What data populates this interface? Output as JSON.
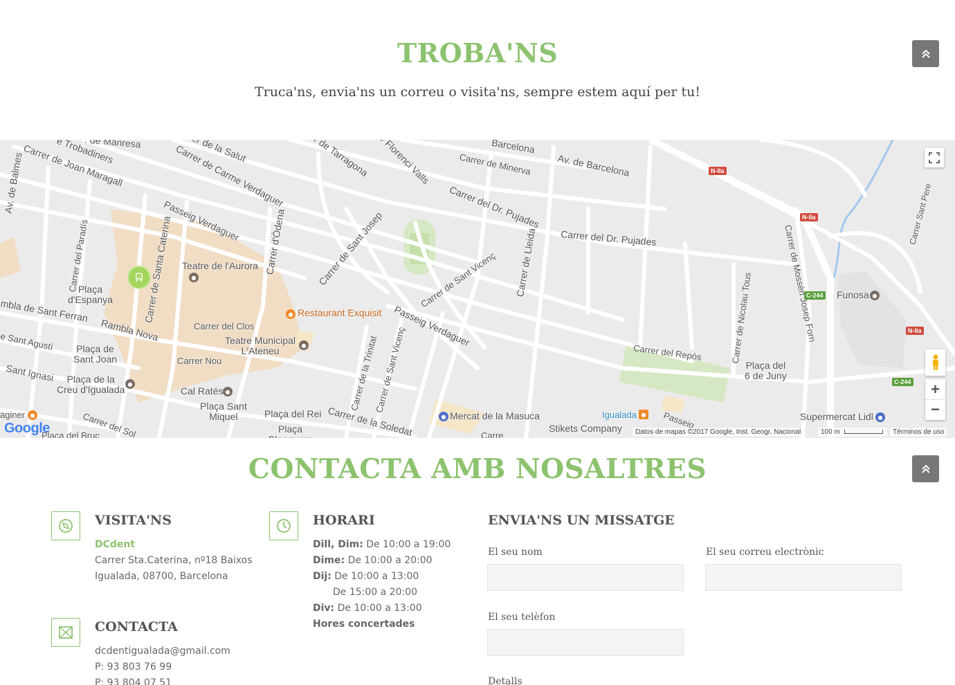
{
  "find": {
    "title": "TROBA'NS",
    "subtitle": "Truca'ns, envia'ns un correu o visita'ns, sempre estem aquí per tu!"
  },
  "map": {
    "streets": [
      "Carrer de Joan Maragall",
      "e Trobadiners",
      ". de Manresa",
      "Carrer de Carme Verdaguer",
      "er de la Salut",
      "er de Tarragona",
      "de Florenci Valls",
      "Barcelona",
      "Carrer de Minerva",
      "Av. de Barcelona",
      "Carrer del Dr. Pujades",
      "Carrer del Dr. Pujades",
      "Passeig Verdaguer",
      "Carrer d'Òdena",
      "Carrer de Sant Josep",
      "Carrer de Sant Vicenç",
      "Carrer de Lleida",
      "Carrer del Paradís",
      "Av. de Balmes",
      "Carrer de Santa Caterina",
      "mbla de Sant Ferran",
      "Rambla Nova",
      "e Sant Agustí",
      "Sant Ignasi",
      "Carrer del Clos",
      "Carrer Nou",
      "Passeig Verdaguer",
      "Carrer de la Trinitat",
      "Carrer de Sant Vicenç",
      "Carrer de la Soledat",
      "Carrer del Sol",
      "Carrer del Repòs",
      "Carrer de Nicolau Tous",
      "Carrer de Mossèn Josep Forn",
      "Carrer Sant Pere",
      "Passeig"
    ],
    "places": {
      "teatre_aurora": "Teatre de l'Aurora",
      "placa_espanya": "Plaça\nd'Espanya",
      "restaurant": "Restaurant Exquisit",
      "teatre_municipal": "Teatre Municipal\nL'Ateneu",
      "placa_sant_joan": "Plaça de\nSant Joan",
      "placa_creu": "Plaça de la\nCreu d'Igualada",
      "cal_rates": "Cal Ratés",
      "placa_sant_miquel": "Plaça Sant\nMiquel",
      "placa_rei": "Plaça del Rei",
      "placa_blanquers": "Plaça\nBlanquers",
      "placa_bruc": "Plaça del Bruc",
      "mercat": "Mercat de la Masuca",
      "igualada": "Igualada",
      "stikets": "Stikets Company",
      "placa_6_juny": "Plaça del\n6 de Juny",
      "funosa": "Funosa",
      "lidl": "Supermercat Lidl",
      "aginer": "aginer",
      "carre": "Carre"
    },
    "shields": [
      "N-IIa",
      "N-IIa",
      "N-IIa",
      "C-244",
      "C-244"
    ],
    "attribution": "Datos de mapas ©2017 Google, Inst. Geogr. Nacional",
    "scale": "100 m",
    "terms": "Términos de uso",
    "logo": "Google"
  },
  "contact": {
    "title": "CONTACTA AMB NOSALTRES",
    "visit": {
      "heading": "VISITA'NS",
      "name": "DCdent",
      "address1": "Carrer Sta.Caterina, nº18 Baixos",
      "address2": "Igualada, 08700, Barcelona"
    },
    "hours": {
      "heading": "HORARI",
      "rows": [
        {
          "day": "Dill, Dim:",
          "time": "De 10:00 a 19:00"
        },
        {
          "day": "Dime:",
          "time": "De 10:00 a 20:00"
        },
        {
          "day": "Dij:",
          "time": "De 10:00 a 13:00"
        },
        {
          "day": "",
          "time": "De 15:00 a 20:00"
        },
        {
          "day": "Div:",
          "time": "De 10:00 a 13:00"
        }
      ],
      "note": "Hores concertades"
    },
    "info": {
      "heading": "CONTACTA",
      "email": "dcdentigualada@gmail.com",
      "phone1": "P: 93 803 76 99",
      "phone2": "P: 93 804 07 51"
    },
    "form": {
      "heading": "ENVIA'NS UN MISSATGE",
      "name_label": "El seu nom",
      "email_label": "El seu correu electrònic",
      "phone_label": "El seu telèfon",
      "details_label": "Detalls",
      "name_value": "",
      "email_value": "",
      "phone_value": ""
    }
  },
  "colors": {
    "accent": "#8dc26f",
    "button": "#777777"
  },
  "icons": {
    "up": "chevron-double-up-icon",
    "compass": "compass-icon",
    "clock": "clock-icon",
    "mail": "mail-icon"
  }
}
